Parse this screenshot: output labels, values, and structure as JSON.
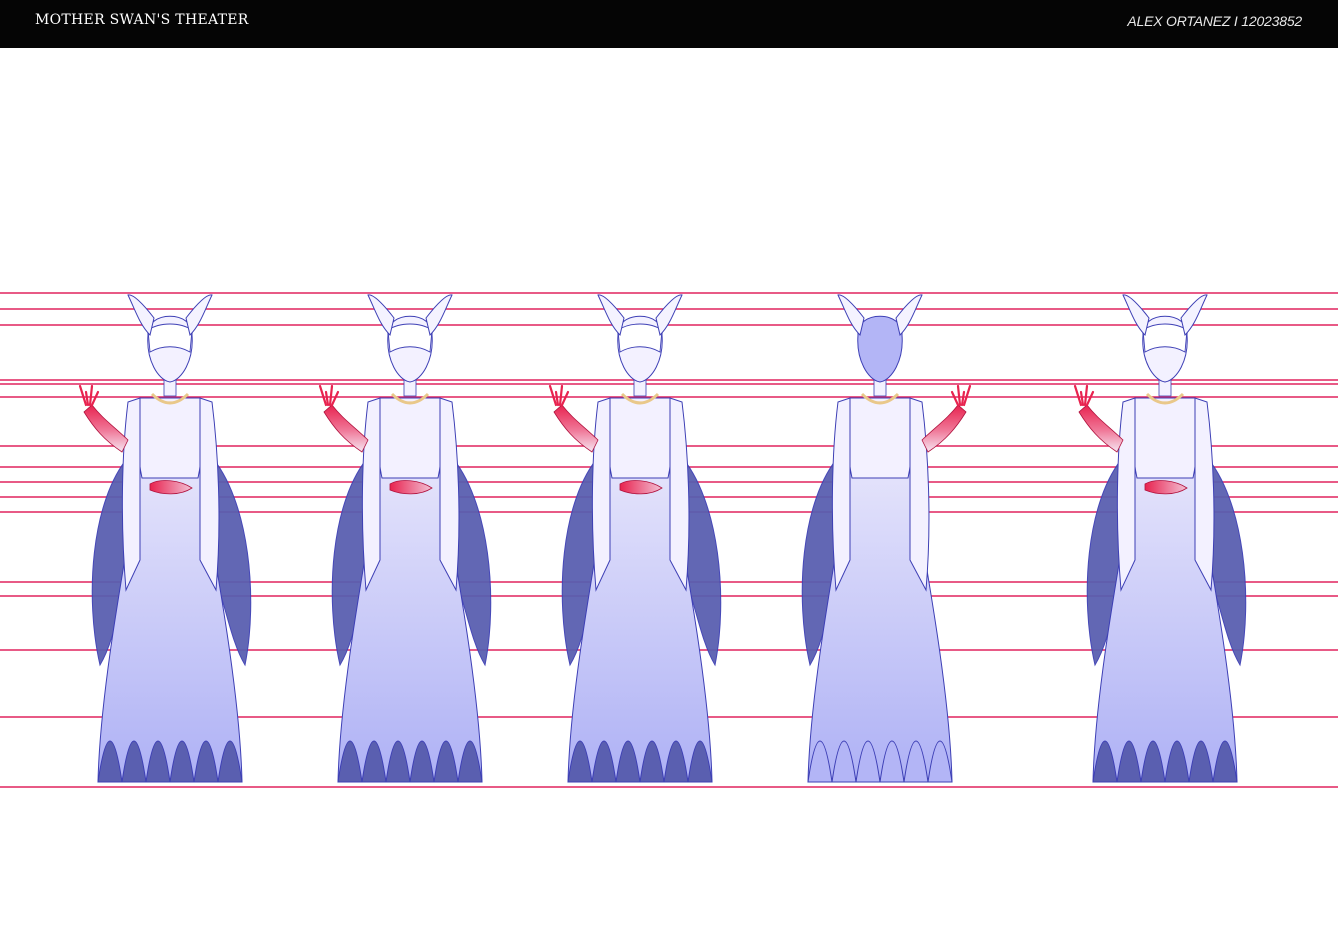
{
  "header": {
    "project_title": "MOTHER SWAN'S THEATER",
    "artist_credit": "ALEX ORTANEZ I 12023852"
  },
  "turnaround": {
    "views": [
      {
        "id": "seated-front"
      },
      {
        "id": "three-quarter-front"
      },
      {
        "id": "side"
      },
      {
        "id": "back"
      },
      {
        "id": "three-quarter-alt"
      }
    ]
  },
  "colors": {
    "header_bg": "#050505",
    "guide_line": "#e0245e",
    "body_light": "#f3f1ff",
    "body_mid": "#b3b5f6",
    "body_dark": "#5a5fb0",
    "hand_red": "#e8234f",
    "collar_gold": "#e9c88a"
  }
}
